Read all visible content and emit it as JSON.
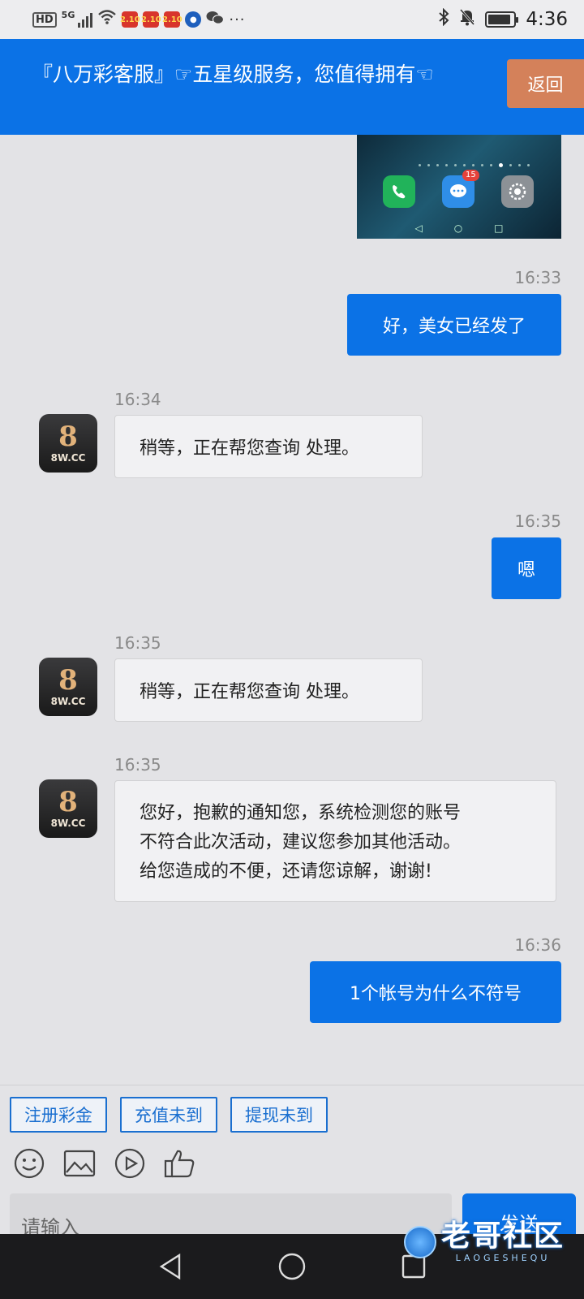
{
  "status_bar": {
    "hd": "HD",
    "network": "5G",
    "app_badges": [
      "2.10",
      "2.10",
      "2.10"
    ],
    "more": "···",
    "time": "4:36"
  },
  "header": {
    "title": "『八万彩客服』☞五星级服务，您值得拥有☜",
    "back_label": "返回"
  },
  "shared_image": {
    "notification_badge": "15"
  },
  "messages": [
    {
      "side": "out",
      "time": "16:33",
      "text": "好，美女已经发了"
    },
    {
      "side": "in",
      "time": "16:34",
      "text": "稍等，正在帮您查询 处理。"
    },
    {
      "side": "out",
      "time": "16:35",
      "text": "嗯"
    },
    {
      "side": "in",
      "time": "16:35",
      "text": "稍等，正在帮您查询 处理。"
    },
    {
      "side": "in",
      "time": "16:35",
      "lines": [
        "您好，抱歉的通知您，系统检测您的账号",
        "不符合此次活动，建议您参加其他活动。",
        "给您造成的不便，还请您谅解，谢谢!"
      ]
    },
    {
      "side": "out",
      "time": "16:36",
      "text": "1个帐号为什么不符号"
    }
  ],
  "avatar": {
    "mark": "8",
    "label": "8W.CC"
  },
  "quick_replies": [
    "注册彩金",
    "充值未到",
    "提现未到"
  ],
  "toolbar_icons": [
    "emoji-icon",
    "image-icon",
    "video-icon",
    "thumbs-up-icon"
  ],
  "input": {
    "placeholder": "请输入"
  },
  "send_label": "发送",
  "watermark": {
    "main": "老哥社区",
    "sub": "LAOGESHEQU"
  },
  "colors": {
    "primary": "#0b72e6",
    "back_button": "#d4815a",
    "background": "#e3e3e6"
  }
}
